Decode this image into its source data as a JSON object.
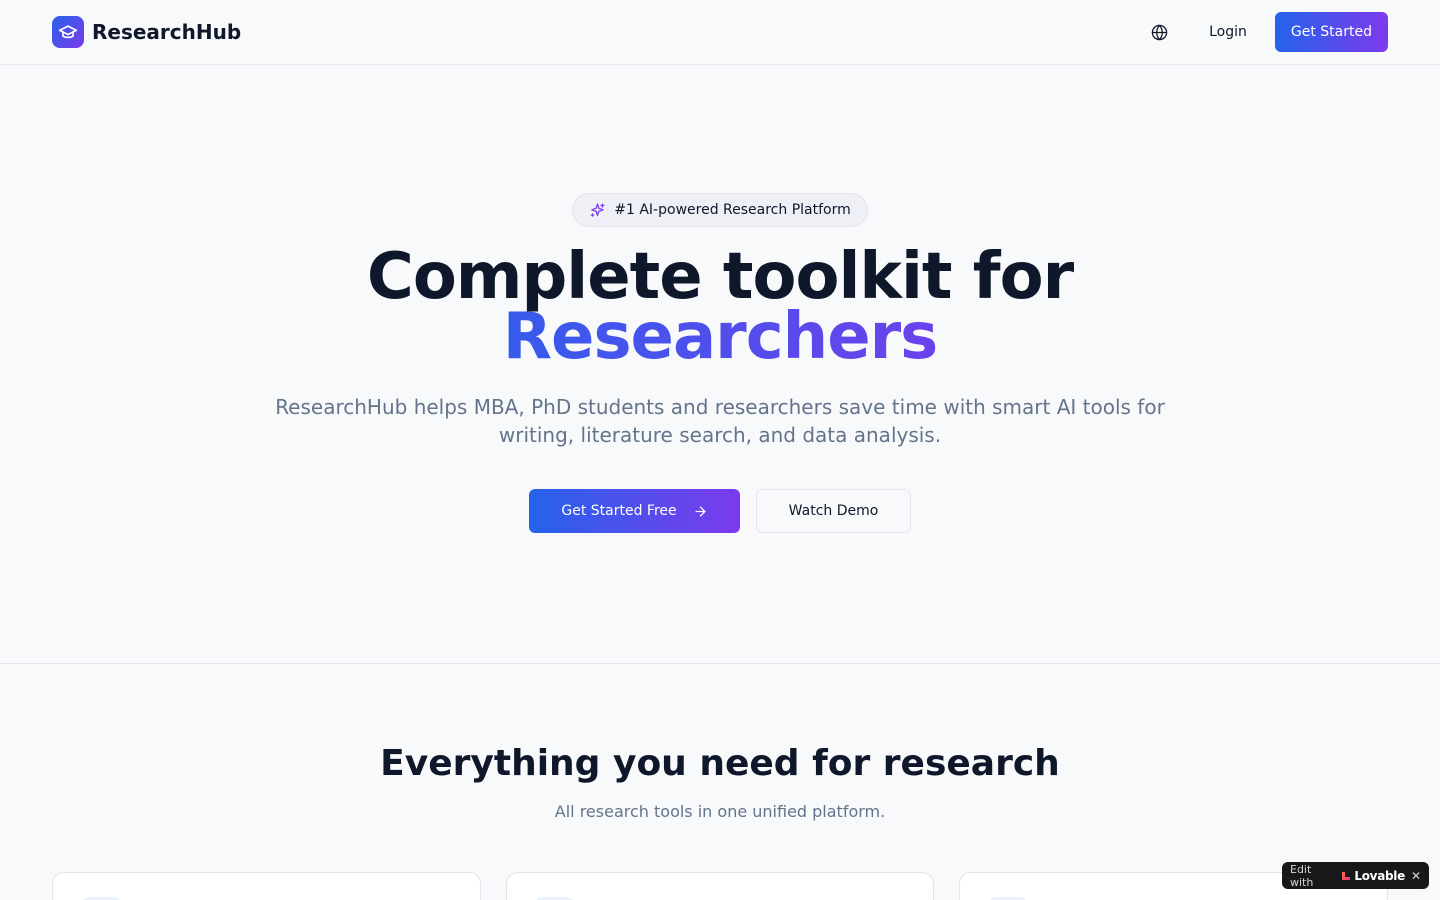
{
  "nav": {
    "brand": "ResearchHub",
    "login": "Login",
    "get_started": "Get Started"
  },
  "hero": {
    "badge": "#1 AI-powered Research Platform",
    "title_line1": "Complete toolkit for",
    "title_line2": "Researchers",
    "subtitle": "ResearchHub helps MBA, PhD students and researchers save time with smart AI tools for writing, literature search, and data analysis.",
    "cta_primary": "Get Started Free",
    "cta_secondary": "Watch Demo"
  },
  "features": {
    "title": "Everything you need for research",
    "subtitle": "All research tools in one unified platform."
  },
  "lovable_badge": {
    "edit_with": "Edit with",
    "brand": "Lovable",
    "close": "✕"
  },
  "colors": {
    "accent_start": "#2563eb",
    "accent_end": "#7c3aed",
    "text_dark": "#0f172a",
    "text_muted": "#64748b",
    "background": "#f8f9fb"
  },
  "icons": {
    "brand": "graduation-cap-icon",
    "language": "globe-icon",
    "badge": "sparkles-icon",
    "cta": "arrow-right-icon"
  }
}
